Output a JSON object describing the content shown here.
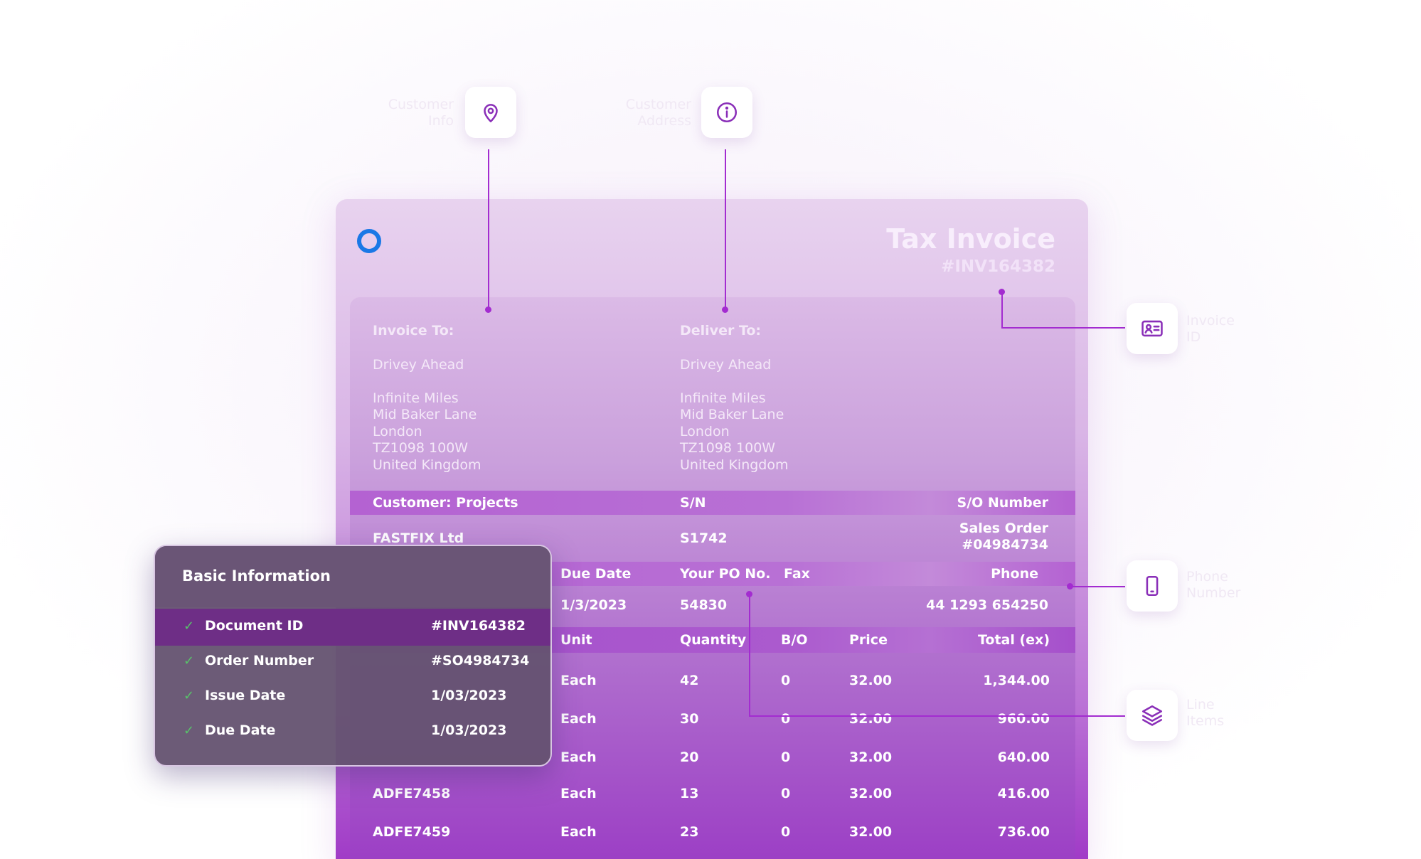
{
  "callouts": {
    "customer_info": {
      "label_line1": "Customer",
      "label_line2": "Info",
      "icon": "map-pin-icon"
    },
    "customer_address": {
      "label_line1": "Customer",
      "label_line2": "Address",
      "icon": "info-icon"
    },
    "invoice_id": {
      "label_line1": "Invoice",
      "label_line2": "ID",
      "icon": "id-card-icon"
    },
    "phone": {
      "label_line1": "Phone",
      "label_line2": "Number",
      "icon": "phone-icon"
    },
    "line_items": {
      "label_line1": "Line",
      "label_line2": "Items",
      "icon": "layers-icon"
    }
  },
  "invoice": {
    "title": "Tax Invoice",
    "number": "#INV164382",
    "invoice_to": {
      "heading": "Invoice To:",
      "name": "Drivey Ahead",
      "address": [
        "Infinite Miles",
        "Mid Baker Lane",
        "London",
        "TZ1098 100W",
        "United Kingdom"
      ]
    },
    "deliver_to": {
      "heading": "Deliver To:",
      "name": "Drivey Ahead",
      "address": [
        "Infinite Miles",
        "Mid Baker Lane",
        "London",
        "TZ1098 100W",
        "United Kingdom"
      ]
    },
    "customer_header": {
      "customer": "Customer: Projects",
      "sn": "S/N",
      "so_number": "S/O Number"
    },
    "customer_row": {
      "customer": "FASTFIX Ltd",
      "sn": "S1742",
      "so_line1": "Sales Order",
      "so_line2": "#04984734"
    },
    "order_header": {
      "due_date": "Due Date",
      "po": "Your PO No.",
      "fax": "Fax",
      "phone": "Phone"
    },
    "order_row": {
      "due_date": "1/3/2023",
      "po": "54830",
      "fax": "",
      "phone": "44 1293 654250"
    },
    "items_header": {
      "code": "",
      "unit": "Unit",
      "quantity": "Quantity",
      "bo": "B/O",
      "price": "Price",
      "total": "Total (ex)"
    },
    "items": [
      {
        "code": "",
        "unit": "Each",
        "quantity": "42",
        "bo": "0",
        "price": "32.00",
        "total": "1,344.00"
      },
      {
        "code": "",
        "unit": "Each",
        "quantity": "30",
        "bo": "0",
        "price": "32.00",
        "total": "960.00"
      },
      {
        "code": "",
        "unit": "Each",
        "quantity": "20",
        "bo": "0",
        "price": "32.00",
        "total": "640.00"
      },
      {
        "code": "ADFE7458",
        "unit": "Each",
        "quantity": "13",
        "bo": "0",
        "price": "32.00",
        "total": "416.00"
      },
      {
        "code": "ADFE7459",
        "unit": "Each",
        "quantity": "23",
        "bo": "0",
        "price": "32.00",
        "total": "736.00"
      }
    ]
  },
  "basic_info": {
    "title": "Basic Information",
    "check_glyph": "✓",
    "rows": [
      {
        "label": "Document ID",
        "value": "#INV164382"
      },
      {
        "label": "Order Number",
        "value": "#SO4984734"
      },
      {
        "label": "Issue Date",
        "value": "1/03/2023"
      },
      {
        "label": "Due Date",
        "value": "1/03/2023"
      }
    ]
  },
  "colors": {
    "accent": "#a32cd0",
    "logo": "#1a78e6",
    "check": "#58c26a"
  }
}
